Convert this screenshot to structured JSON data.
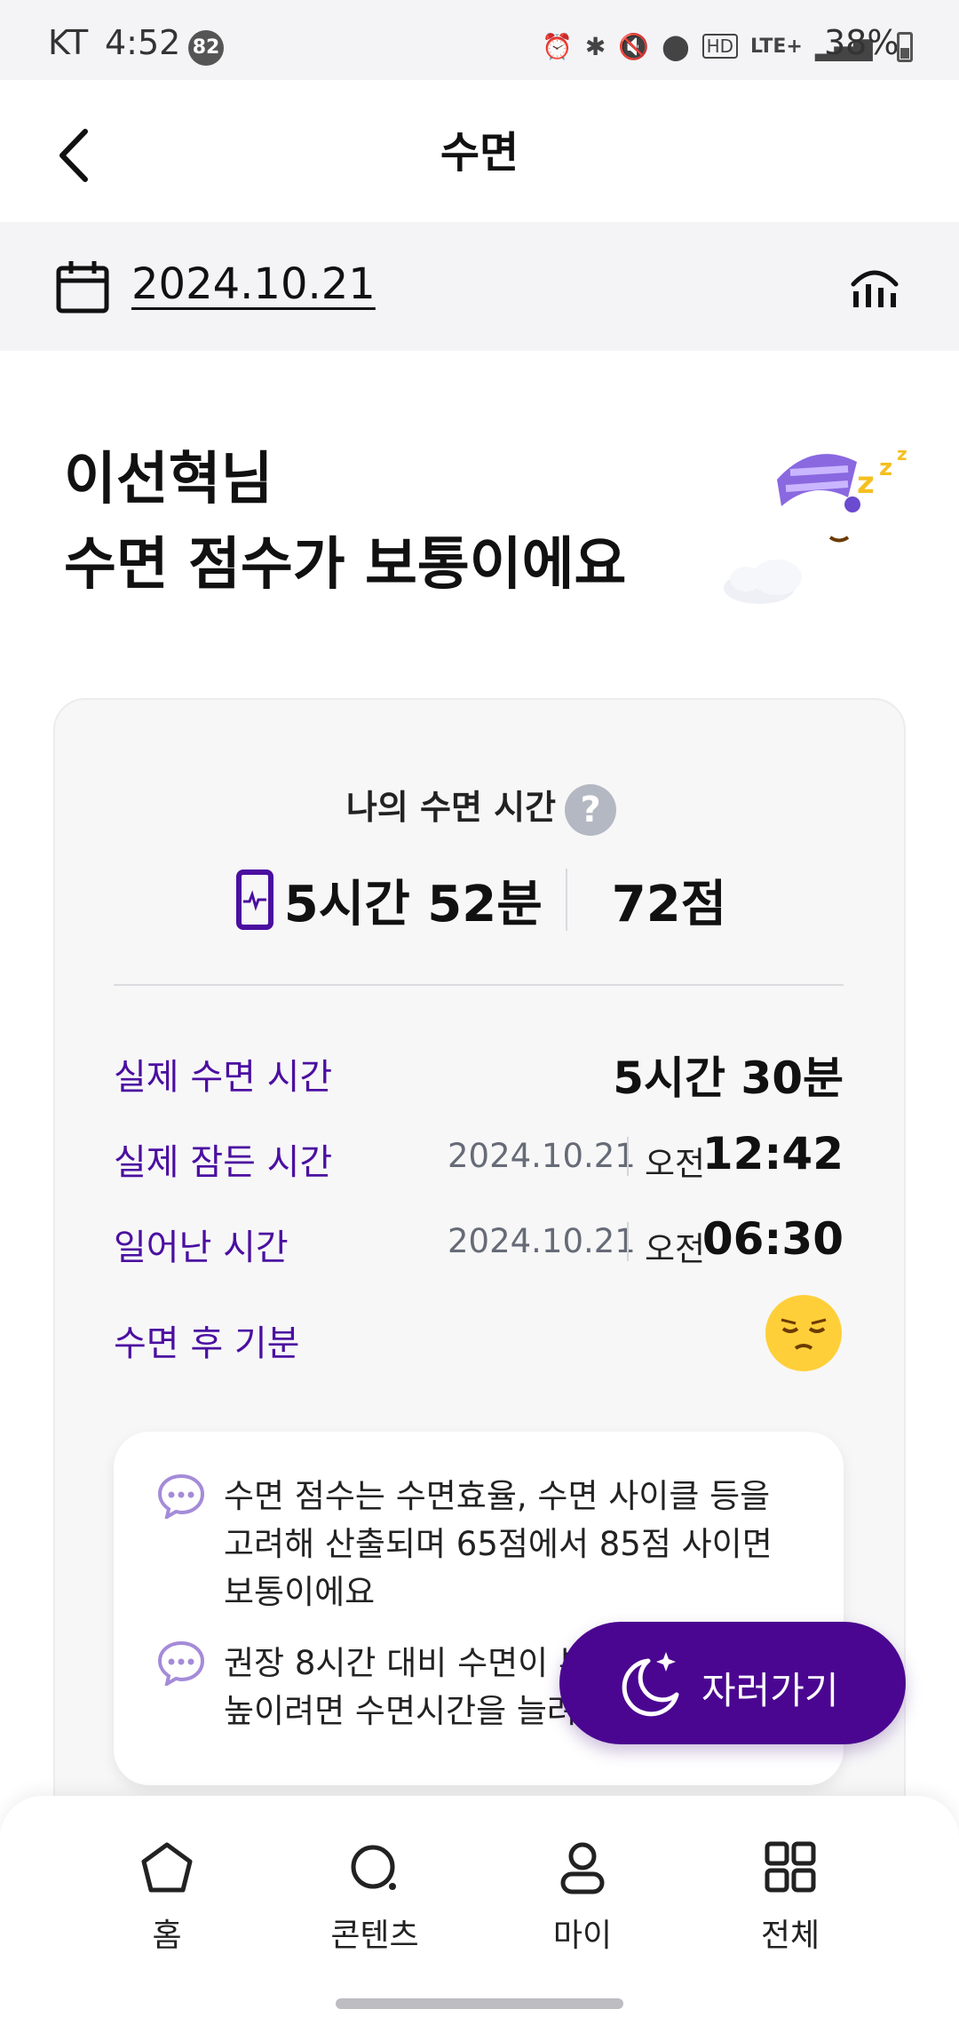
{
  "status_bar": {
    "carrier": "KT",
    "time": "4:52",
    "notification_count": "82",
    "battery": "38%"
  },
  "header": {
    "title": "수면"
  },
  "date_bar": {
    "date": "2024.10.21"
  },
  "headline": {
    "line1": "이선혁님",
    "line2": "수면 점수가 보통이에요"
  },
  "card": {
    "title": "나의 수면 시간",
    "total_time": "5시간 52분",
    "score": "72점",
    "rows": {
      "actual_sleep": {
        "label": "실제 수면 시간",
        "value": "5시간 30분"
      },
      "fell_asleep": {
        "label": "실제 잠든 시간",
        "date": "2024.10.21",
        "ampm": "오전",
        "time": "12:42"
      },
      "woke_up": {
        "label": "일어난 시간",
        "date": "2024.10.21",
        "ampm": "오전",
        "time": "06:30"
      },
      "mood": {
        "label": "수면 후 기분"
      }
    },
    "tips": [
      "수면 점수는 수면효율, 수면 사이클 등을 고려해 산출되며 65점에서 85점 사이면 보통이에요",
      "권장 8시간 대비 수면이 부족해요. 점수를 높이려면 수면시간을 늘려보세요"
    ]
  },
  "sleep_button": {
    "label": "자러가기"
  },
  "bottom_nav": {
    "items": [
      {
        "label": "홈",
        "icon": "home-icon"
      },
      {
        "label": "콘텐츠",
        "icon": "search-icon"
      },
      {
        "label": "마이",
        "icon": "person-icon"
      },
      {
        "label": "전체",
        "icon": "grid-icon"
      }
    ]
  },
  "colors": {
    "accent": "#4a0690",
    "label_purple": "#4b0fa0",
    "card_bg": "#f7f7f8"
  }
}
